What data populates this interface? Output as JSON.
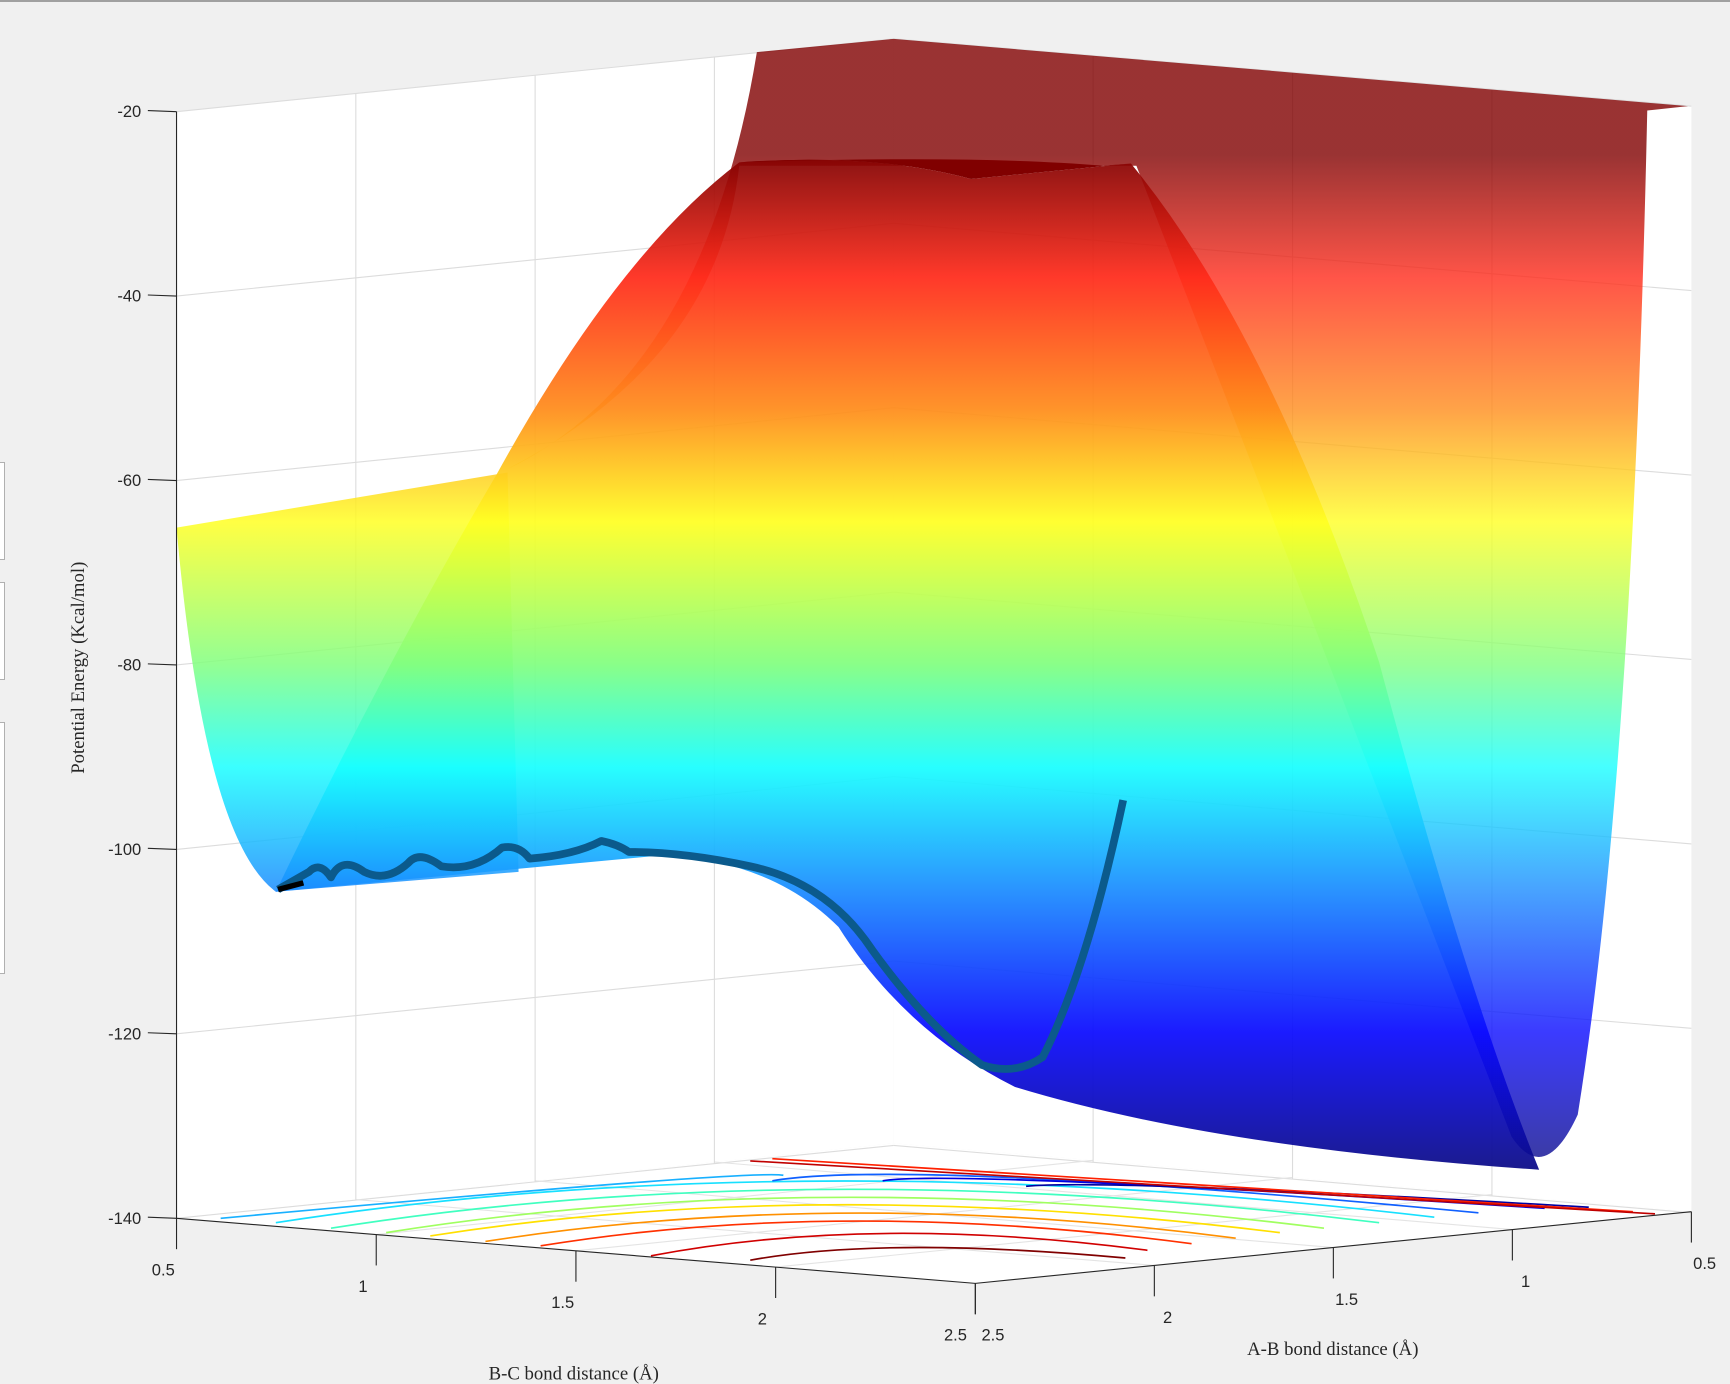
{
  "chart_data": {
    "type": "surface",
    "title": "",
    "xlabel": "B-C bond distance (Å)",
    "ylabel": "A-B bond distance (Å)",
    "zlabel": "Potential Energy (Kcal/mol)",
    "xlim": [
      0.5,
      2.5
    ],
    "ylim": [
      0.5,
      2.5
    ],
    "zlim": [
      -140,
      -20
    ],
    "xticks": [
      "0.5",
      "1",
      "1.5",
      "2",
      "2.5"
    ],
    "yticks": [
      "0.5",
      "1",
      "1.5",
      "2",
      "2.5"
    ],
    "zticks": [
      "-20",
      "-40",
      "-60",
      "-80",
      "-100",
      "-120",
      "-140"
    ],
    "colormap": "jet",
    "grid": true,
    "surface": {
      "description_levels": {
        "ridge_max_z": -25,
        "product_valley_min_z": -104,
        "reactant_valley_min_z": -134,
        "saddle_z": -101
      }
    },
    "trajectory": {
      "color": "#0b5a8c",
      "start_z": -95,
      "end_z": -104
    },
    "contour_plot_on_floor": true
  }
}
